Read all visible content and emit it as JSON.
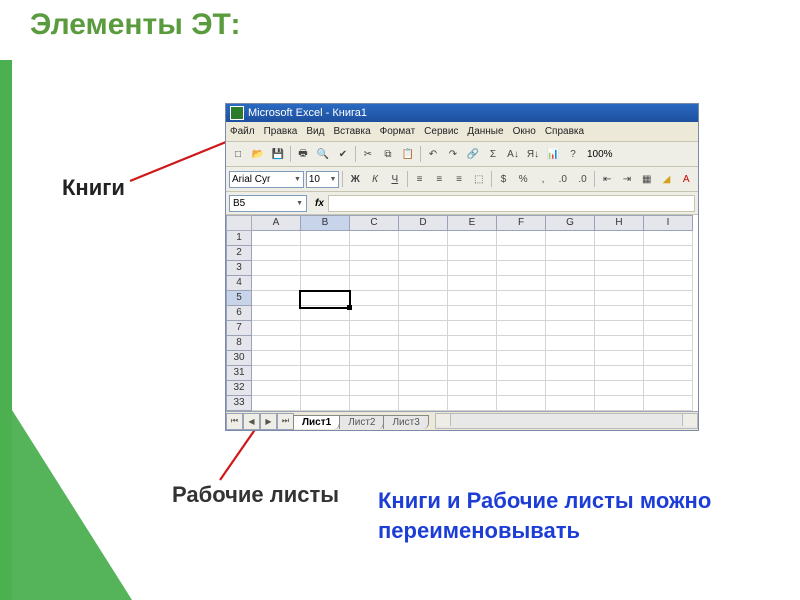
{
  "slide": {
    "title": "Элементы ЭТ:",
    "label_books": "Книги",
    "label_sheets": "Рабочие листы",
    "label_note": "Книги и Рабочие листы можно переименовывать"
  },
  "excel": {
    "app_title": "Microsoft Excel - Книга1",
    "menu": [
      "Файл",
      "Правка",
      "Вид",
      "Вставка",
      "Формат",
      "Сервис",
      "Данные",
      "Окно",
      "Справка"
    ],
    "font_name": "Arial Cyr",
    "font_size": "10",
    "bold": "Ж",
    "italic": "К",
    "underline": "Ч",
    "name_box": "B5",
    "fx_label": "fx",
    "zoom": "100%",
    "columns": [
      "A",
      "B",
      "C",
      "D",
      "E",
      "F",
      "G",
      "H",
      "I"
    ],
    "row_labels": [
      "1",
      "2",
      "3",
      "4",
      "5",
      "6",
      "7",
      "8",
      "30",
      "31",
      "32",
      "33"
    ],
    "active": {
      "col_index": 1,
      "row_index": 4
    },
    "sheet_tabs": [
      "Лист1",
      "Лист2",
      "Лист3"
    ],
    "active_tab": 0,
    "nav_glyphs": [
      "⏮",
      "◀",
      "▶",
      "⏭"
    ]
  },
  "icons": {
    "new": "□",
    "open": "📂",
    "save": "💾",
    "print": "🖶",
    "preview": "🔍",
    "spell": "✔",
    "cut": "✂",
    "copy": "⧉",
    "paste": "📋",
    "undo": "↶",
    "redo": "↷",
    "link": "🔗",
    "sum": "Σ",
    "sort_az": "A↓",
    "sort_za": "Я↓",
    "chart": "📊",
    "help": "?"
  }
}
